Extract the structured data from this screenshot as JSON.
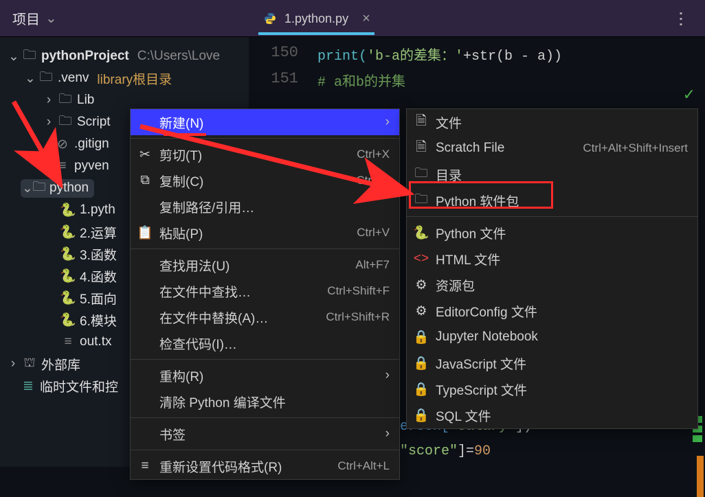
{
  "header": {
    "title": "项目"
  },
  "tab": {
    "filename": "1.python.py"
  },
  "tree": {
    "project": "pythonProject",
    "project_path": "C:\\Users\\Love",
    "venv": ".venv",
    "venv_tag": "library根目录",
    "lib": "Lib",
    "scripts": "Script",
    "gitign": ".gitign",
    "pyvenv": "pyven",
    "python_folder": "python",
    "f1": "1.pyth",
    "f2": "2.运算",
    "f3": "3.函数",
    "f4": "4.函数",
    "f5": "5.面向",
    "f6": "6.模块",
    "out": "out.tx",
    "ext_lib": "外部库",
    "scratch": "临时文件和控"
  },
  "editor": {
    "ln1": "150",
    "ln2": "151",
    "code1_pre": "print(",
    "code1_str": "'b-a的差集：'",
    "code1_mid": "+str(b - a))",
    "code2": "#  a和b的并集",
    "code_low1_a": "erson[",
    "code_low1_b": "\"salary\"",
    "code_low1_c": "])",
    "code_low2_a": "\"score\"",
    "code_low2_b": "]=",
    "code_low2_c": "90"
  },
  "menu1": {
    "new": "新建(N)",
    "cut": "剪切(T)",
    "cut_sc": "Ctrl+X",
    "copy": "复制(C)",
    "copy_sc": "Ctrl+C",
    "copy_path": "复制路径/引用…",
    "paste": "粘贴(P)",
    "paste_sc": "Ctrl+V",
    "find_usage": "查找用法(U)",
    "find_usage_sc": "Alt+F7",
    "find_in": "在文件中查找…",
    "find_in_sc": "Ctrl+Shift+F",
    "replace_in": "在文件中替换(A)…",
    "replace_in_sc": "Ctrl+Shift+R",
    "inspect": "检查代码(I)…",
    "refactor": "重构(R)",
    "clean": "清除 Python 编译文件",
    "bookmark": "书签",
    "reformat": "重新设置代码格式(R)",
    "reformat_sc": "Ctrl+Alt+L"
  },
  "menu2": {
    "file": "文件",
    "scratch": "Scratch File",
    "scratch_sc": "Ctrl+Alt+Shift+Insert",
    "dir": "目录",
    "py_pkg": "Python 软件包",
    "py_file": "Python 文件",
    "html_file": "HTML 文件",
    "res_pkg": "资源包",
    "editorconfig": "EditorConfig 文件",
    "jupyter": "Jupyter Notebook",
    "js_file": "JavaScript 文件",
    "ts_file": "TypeScript 文件",
    "sql_file": "SQL 文件"
  }
}
